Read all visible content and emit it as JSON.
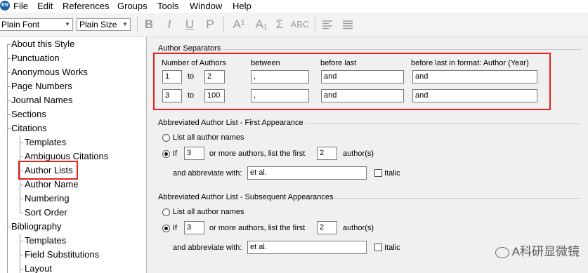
{
  "menubar": {
    "app_icon": "EN",
    "items": [
      "File",
      "Edit",
      "References",
      "Groups",
      "Tools",
      "Window",
      "Help"
    ]
  },
  "toolbar": {
    "font_value": "Plain Font",
    "size_value": "Plain Size",
    "buttons": [
      "B",
      "I",
      "U",
      "P",
      "A¹",
      "A₁",
      "Σ",
      "ABC"
    ],
    "align_left_icon": "align-left-icon",
    "justify_icon": "justify-icon"
  },
  "tree": {
    "items": [
      "About this Style",
      "Punctuation",
      "Anonymous Works",
      "Page Numbers",
      "Journal Names",
      "Sections",
      "Citations",
      "Templates",
      "Ambiguous Citations",
      "Author Lists",
      "Author Name",
      "Numbering",
      "Sort Order",
      "Bibliography",
      "Templates",
      "Field Substitutions",
      "Layout"
    ],
    "selected": "Author Lists"
  },
  "separators": {
    "title": "Author Separators",
    "headers": {
      "num_authors": "Number of Authors",
      "between": "between",
      "before_last": "before last",
      "before_last_format": "before last in format: Author (Year)"
    },
    "rows": [
      {
        "from": "1",
        "to_label": "to",
        "to": "2",
        "between": ",",
        "before_last": "and",
        "before_last_format": "and"
      },
      {
        "from": "3",
        "to_label": "to",
        "to": "100",
        "between": ",",
        "before_last": "and",
        "before_last_format": "and"
      }
    ]
  },
  "first_appearance": {
    "title": "Abbreviated Author List - First Appearance",
    "list_all": "List all author names",
    "if_label": "If",
    "if_value": "3",
    "or_more": "or more authors, list the first",
    "first_value": "2",
    "authors_suffix": "author(s)",
    "abbrev_label": "and abbreviate with:",
    "abbrev_value": "et al.",
    "italic_label": "Italic",
    "selected": "if"
  },
  "subsequent": {
    "title": "Abbreviated Author List - Subsequent Appearances",
    "list_all": "List all author names",
    "if_label": "If",
    "if_value": "3",
    "or_more": "or more authors, list the first",
    "first_value": "2",
    "authors_suffix": "author(s)",
    "abbrev_label": "and abbreviate with:",
    "abbrev_value": "et al.",
    "italic_label": "Italic",
    "selected": "if"
  },
  "watermark": {
    "icon": "wechat-icon",
    "text": "A科研显微镜"
  },
  "colors": {
    "highlight_red": "#e8211d",
    "panel_bg": "#f0f0f0"
  }
}
